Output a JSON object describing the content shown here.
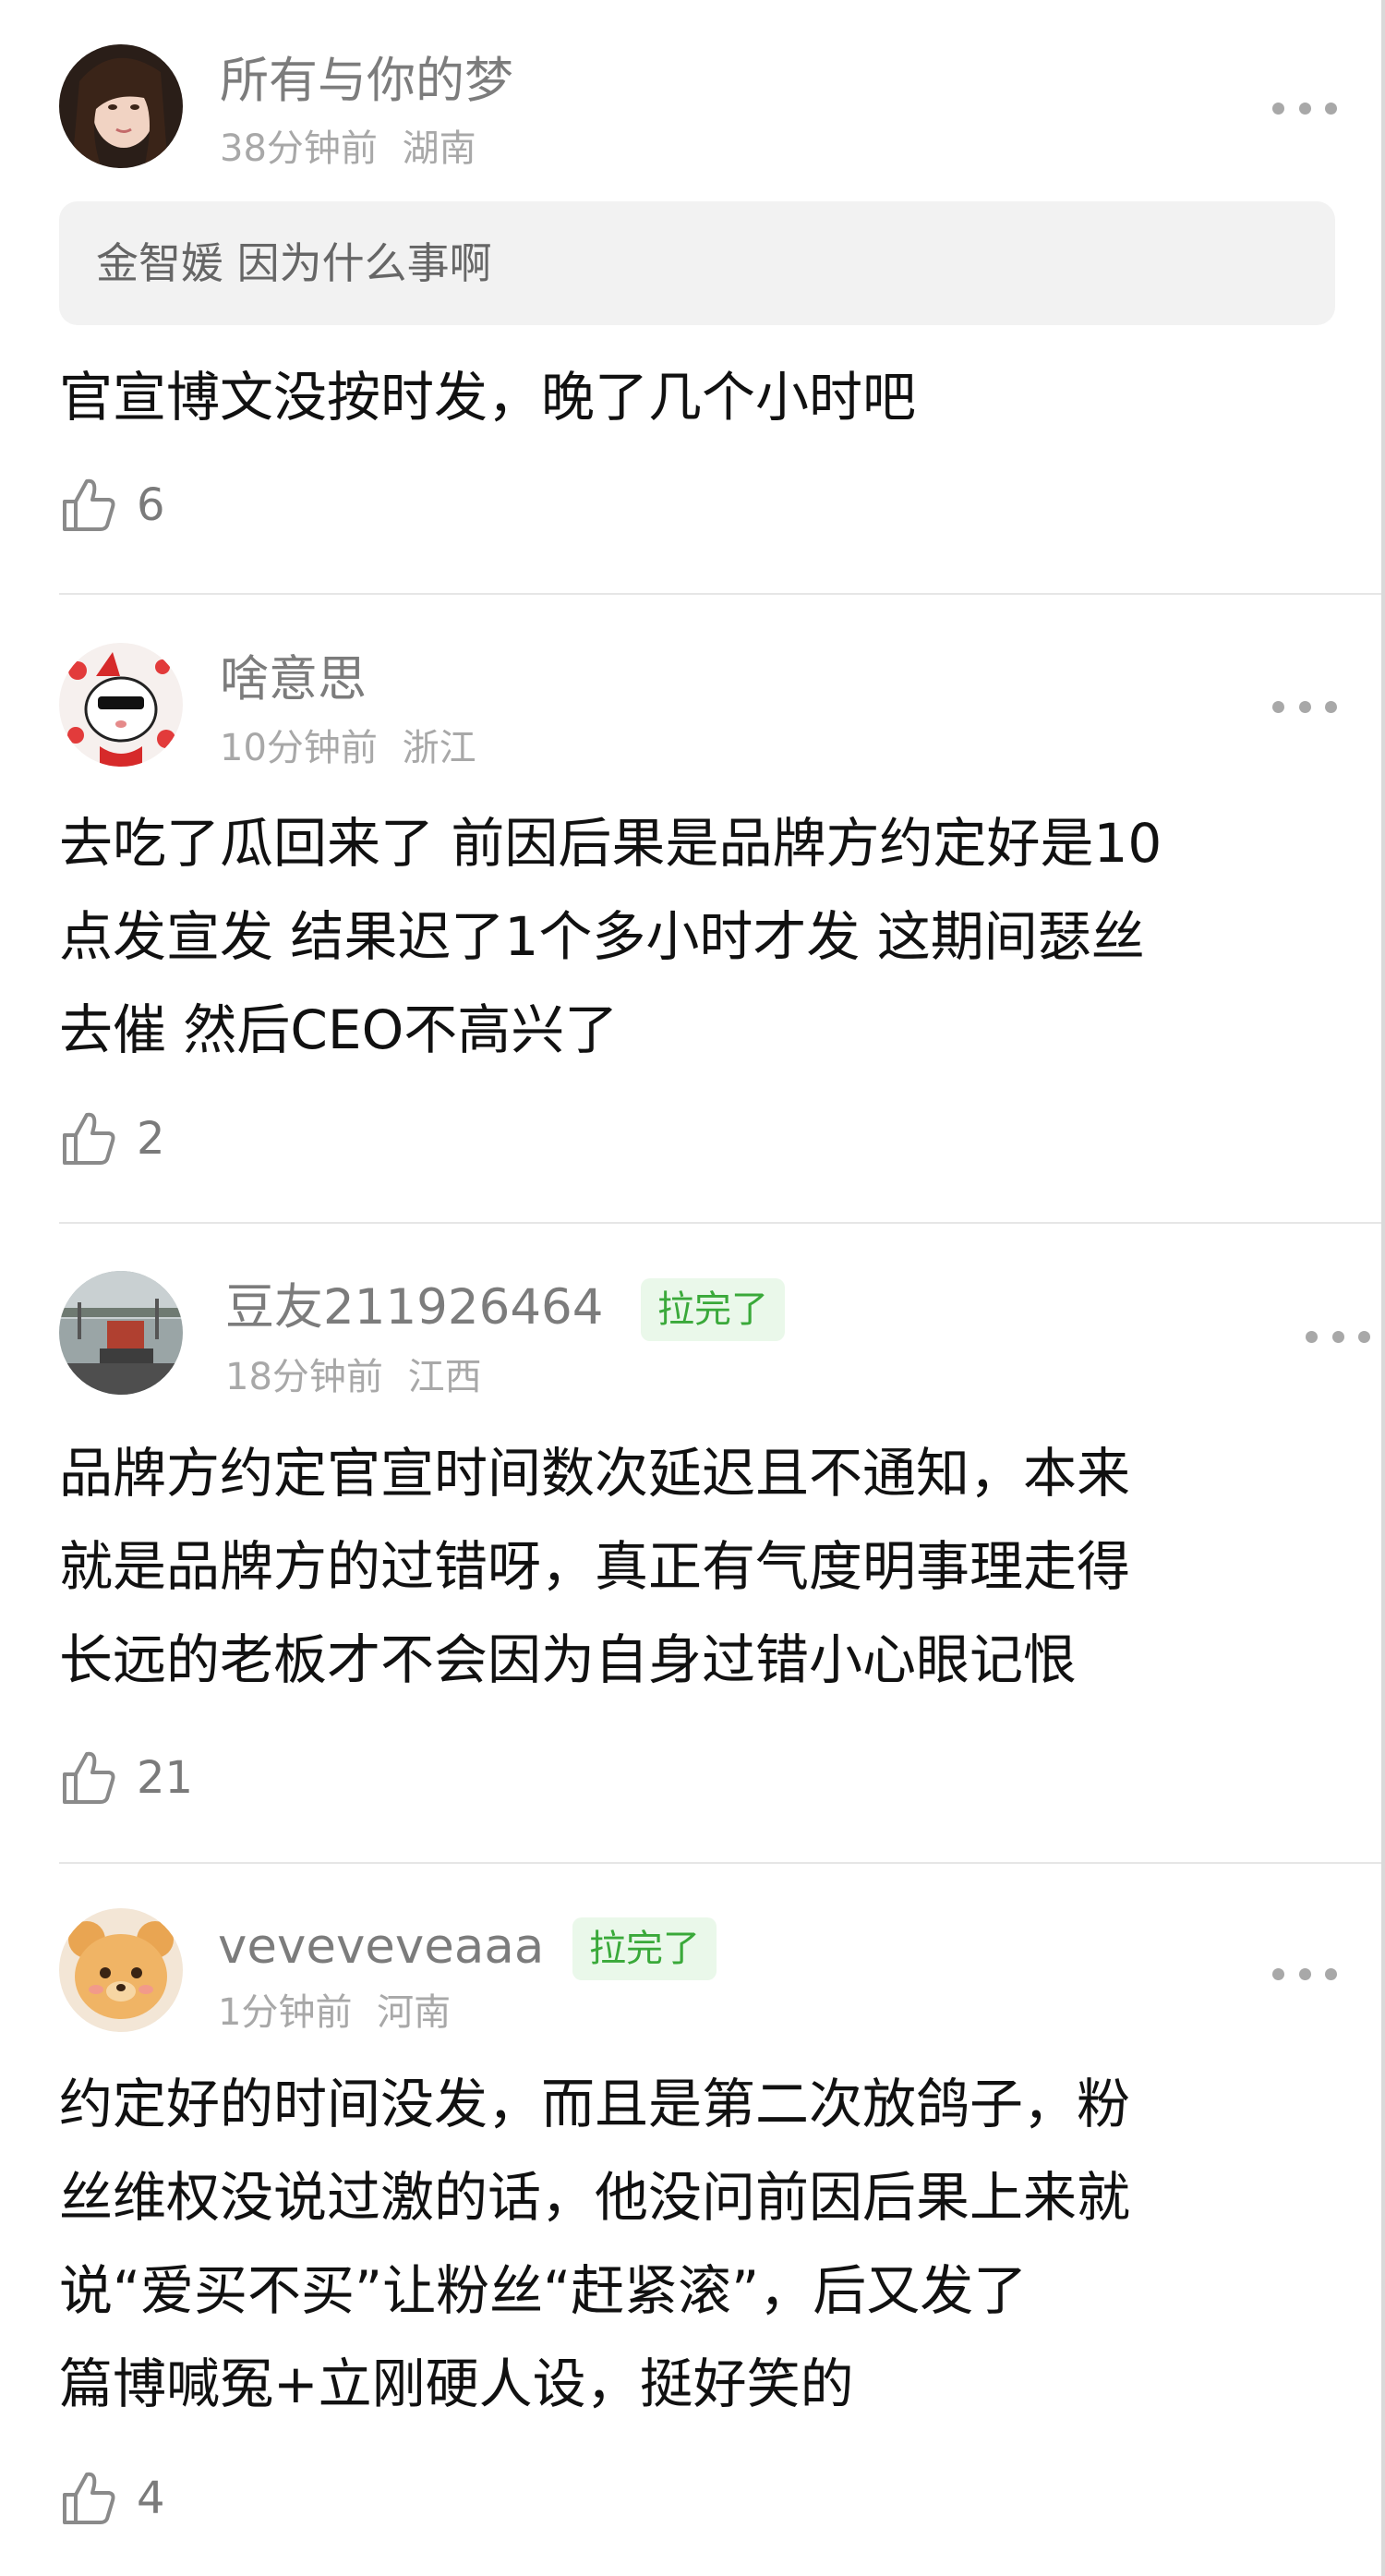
{
  "comments": [
    {
      "username": "所有与你的梦",
      "time": "38分钟前",
      "location": "湖南",
      "quote": "金智媛 因为什么事啊",
      "text": "官宣博文没按时发，晚了几个小时吧",
      "likes": "6",
      "avatar_icon": "user-avatar-photo"
    },
    {
      "username": "啥意思",
      "time": "10分钟前",
      "location": "浙江",
      "text": "去吃了瓜回来了 前因后果是品牌方约定好是10\n点发宣发 结果迟了1个多小时才发 这期间瑟丝\n去催 然后CEO不高兴了",
      "likes": "2",
      "avatar_icon": "cartoon-cat-avatar"
    },
    {
      "username": "豆友211926464",
      "badge": "拉完了",
      "time": "18分钟前",
      "location": "江西",
      "text": "品牌方约定官宣时间数次延迟且不通知，本来\n就是品牌方的过错呀，真正有气度明事理走得\n长远的老板才不会因为自身过错小心眼记恨",
      "likes": "21",
      "avatar_icon": "street-scene-avatar"
    },
    {
      "username": "vevevevea­aa",
      "badge": "拉完了",
      "time": "1分钟前",
      "location": "河南",
      "text": "约定好的时间没发，而且是第二次放鸽子，粉\n丝维权没说过激的话，他没问前因后果上来就\n说“爱买不买”让粉丝“赶紧滚”，后又发了\n篇博喊冤+立刚硬人设，挺好笑的",
      "likes": "4",
      "avatar_icon": "teddy-bear-avatar"
    }
  ]
}
